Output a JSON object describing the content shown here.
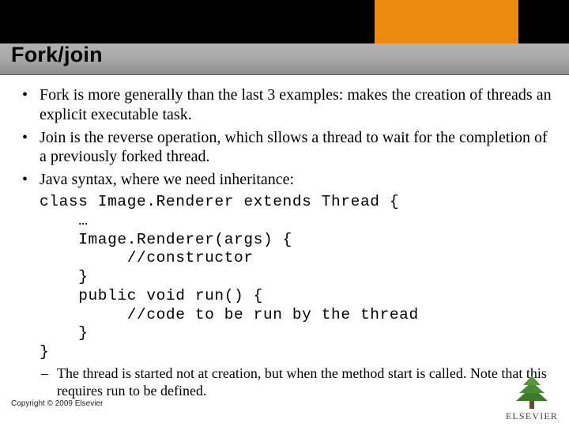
{
  "colors": {
    "accent": "#eb8b0f",
    "bar": "#000000",
    "band_top": "#b2b2b2",
    "band_bot": "#8e8e8e"
  },
  "title": "Fork/join",
  "bullets": [
    "Fork is more generally than the last 3 examples: makes the creation of threads an explicit executable task.",
    "Join is the reverse operation, which sllows a thread to wait for the completion of a previously forked thread.",
    "Java syntax, where we need inheritance:"
  ],
  "code": "class Image.Renderer extends Thread {\n    …\n    Image.Renderer(args) {\n         //constructor\n    }\n    public void run() {\n         //code to be run by the thread\n    }\n}",
  "sub_bullets": [
    "The thread is started not at creation, but when the method start is called.  Note that this requires run to be defined."
  ],
  "copyright": "Copyright © 2009 Elsevier",
  "brand": {
    "name": "ELSEVIER",
    "icon": "elsevier-tree-icon"
  }
}
